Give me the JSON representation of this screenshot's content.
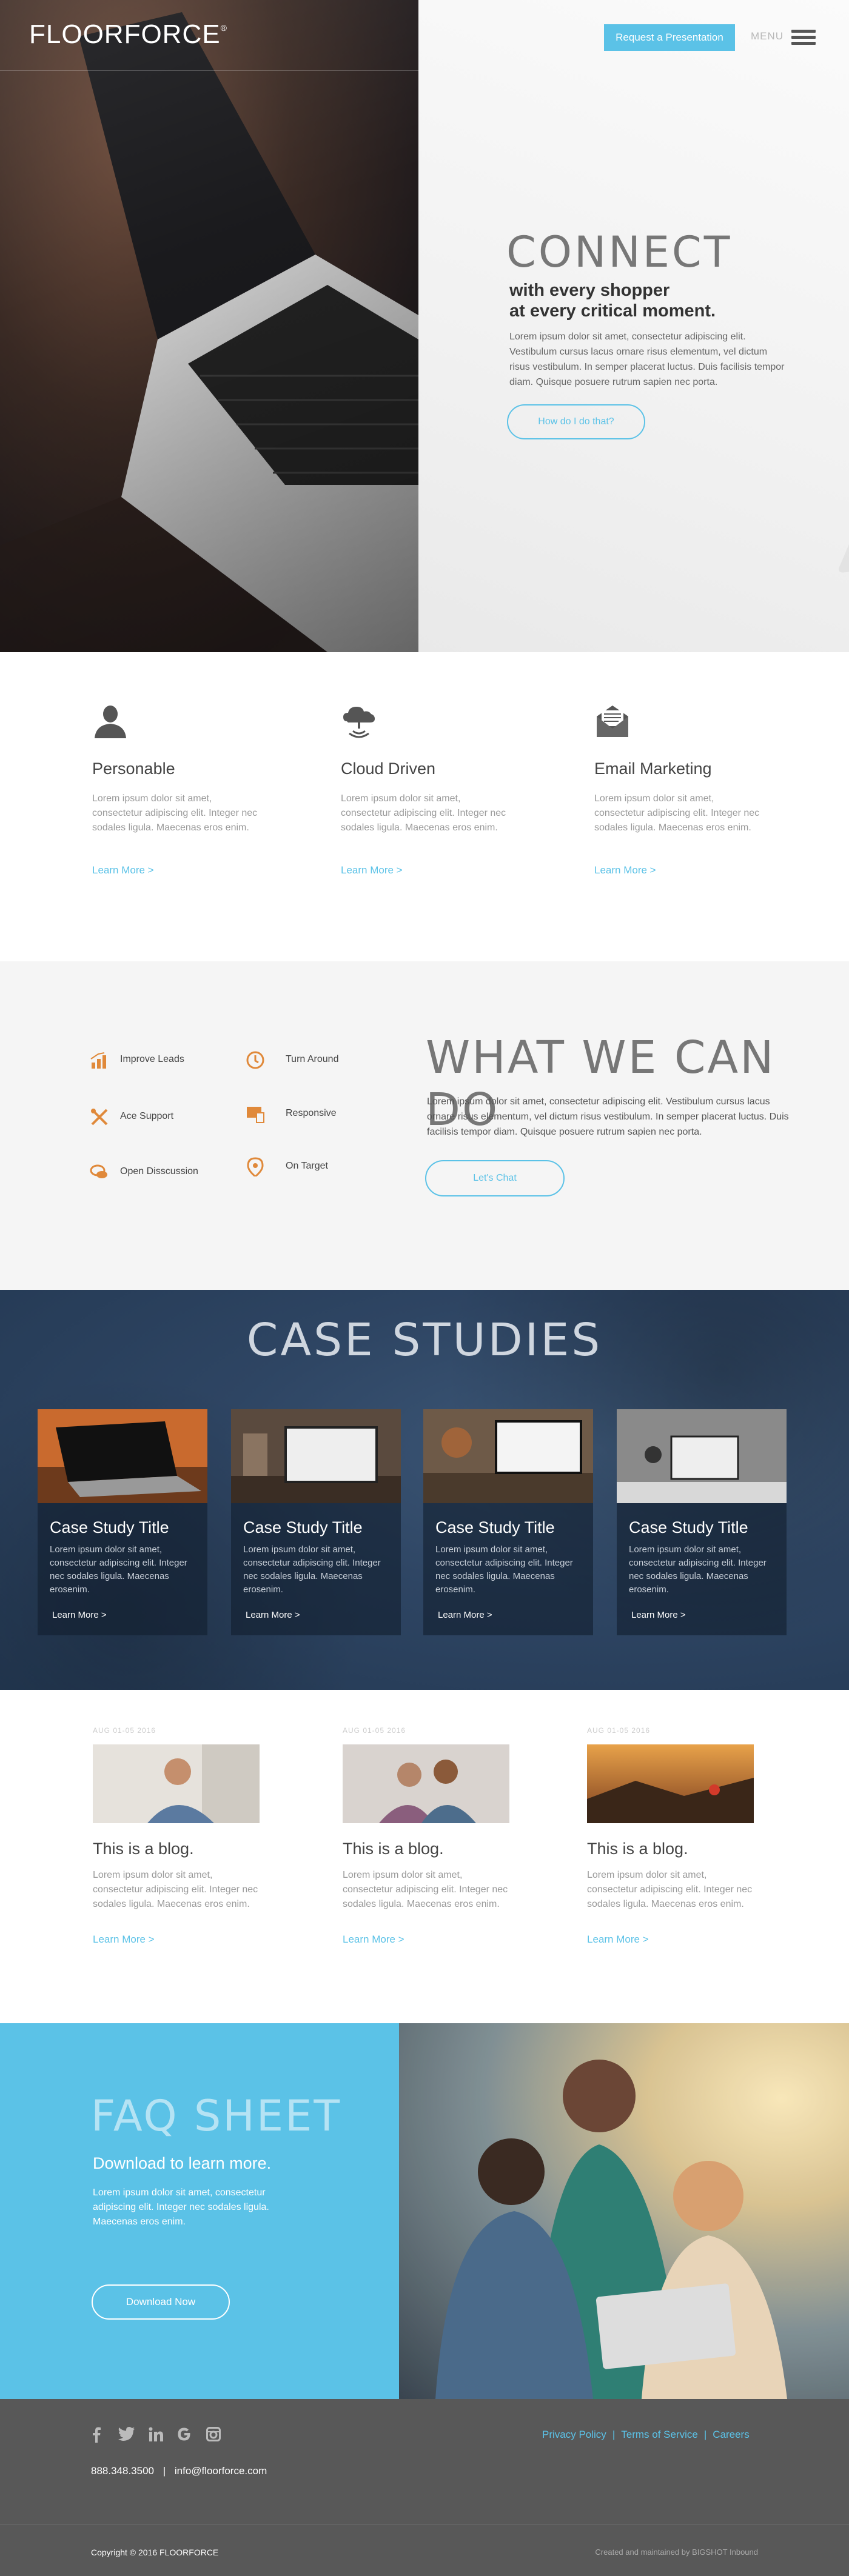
{
  "header": {
    "logo": "FLOORFORCE",
    "logo_mark": "®",
    "cta_label": "Request a Presentation",
    "menu_label": "MENU"
  },
  "hero": {
    "title": "CONNECT",
    "subtitle_line1": "with every shopper",
    "subtitle_line2": "at every critical moment.",
    "body": "Lorem ipsum dolor sit amet, consectetur adipiscing elit. Vestibulum cursus lacus ornare risus elementum, vel dictum risus vestibulum. In semper placerat luctus. Duis facilisis tempor diam. Quisque posuere rutrum sapien nec porta.",
    "button_label": "How do I do that?"
  },
  "features": [
    {
      "icon": "person-icon",
      "title": "Personable",
      "body": "Lorem ipsum dolor sit amet, consectetur adipiscing elit. Integer nec sodales ligula. Maecenas eros enim.",
      "link": "Learn More  >"
    },
    {
      "icon": "cloud-icon",
      "title": "Cloud Driven",
      "body": "Lorem ipsum dolor sit amet, consectetur adipiscing elit. Integer nec sodales ligula. Maecenas eros enim.",
      "link": "Learn More  >"
    },
    {
      "icon": "envelope-icon",
      "title": "Email Marketing",
      "body": "Lorem ipsum dolor sit amet, consectetur adipiscing elit. Integer nec sodales ligula. Maecenas eros enim.",
      "link": "Learn More  >"
    }
  ],
  "services": {
    "items": [
      "Improve Leads",
      "Turn Around",
      "Ace Support",
      "Responsive",
      "Open Disscussion",
      "On Target"
    ],
    "title": "WHAT WE CAN DO",
    "body": "Lorem ipsum dolor sit amet, consectetur adipiscing elit. Vestibulum cursus lacus ornare risus elementum, vel dictum risus vestibulum. In semper placerat luctus. Duis facilisis tempor diam. Quisque posuere rutrum sapien nec porta.",
    "button_label": "Let's Chat"
  },
  "case_studies": {
    "title": "CASE STUDIES",
    "items": [
      {
        "title": "Case Study Title",
        "body": "Lorem ipsum dolor sit amet, consectetur adipiscing elit. Integer nec sodales ligula. Maecenas erosenim.",
        "link": "Learn More >"
      },
      {
        "title": "Case Study Title",
        "body": "Lorem ipsum dolor sit amet, consectetur adipiscing elit. Integer nec sodales ligula. Maecenas erosenim.",
        "link": "Learn More >"
      },
      {
        "title": "Case Study Title",
        "body": "Lorem ipsum dolor sit amet, consectetur adipiscing elit. Integer nec sodales ligula. Maecenas erosenim.",
        "link": "Learn More >"
      },
      {
        "title": "Case Study Title",
        "body": "Lorem ipsum dolor sit amet, consectetur adipiscing elit. Integer nec sodales ligula. Maecenas erosenim.",
        "link": "Learn More >"
      }
    ]
  },
  "blog": [
    {
      "date": "AUG 01-05 2016",
      "title": "This is a blog.",
      "body": "Lorem ipsum dolor sit amet, consectetur adipiscing elit. Integer nec sodales ligula. Maecenas eros enim.",
      "link": "Learn More  >"
    },
    {
      "date": "AUG 01-05 2016",
      "title": "This is a blog.",
      "body": "Lorem ipsum dolor sit amet, consectetur adipiscing elit. Integer nec sodales ligula. Maecenas eros enim.",
      "link": "Learn More  >"
    },
    {
      "date": "AUG 01-05 2016",
      "title": "This is a blog.",
      "body": "Lorem ipsum dolor sit amet, consectetur adipiscing elit. Integer nec sodales ligula. Maecenas eros enim.",
      "link": "Learn More  >"
    }
  ],
  "faq": {
    "title": "FAQ SHEET",
    "subtitle": "Download to learn more.",
    "body": "Lorem ipsum dolor sit amet, consectetur adipiscing elit. Integer nec sodales ligula. Maecenas eros enim.",
    "button_label": "Download Now"
  },
  "footer": {
    "social": [
      "f",
      "t",
      "in",
      "G",
      "ig"
    ],
    "links": [
      "Privacy Policy",
      "Terms of Service",
      "Careers"
    ],
    "phone": "888.348.3500",
    "email": "info@floorforce.com",
    "copyright": "Copyright © 2016  FLOORFORCE",
    "credit": "Created and maintained by BIGSHOT Inbound"
  },
  "colors": {
    "accent": "#5bc2e7",
    "icon_orange": "#e0893a",
    "footer": "#585858",
    "case_bg": "#2e4563"
  }
}
